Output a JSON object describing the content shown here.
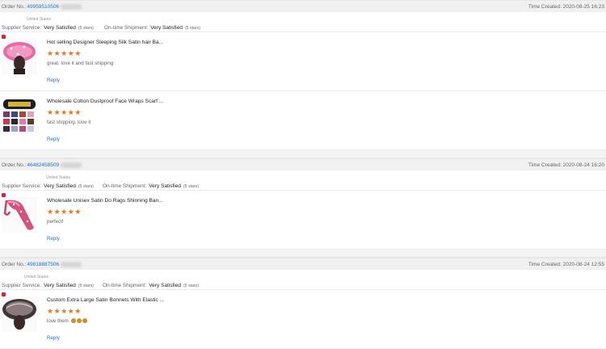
{
  "labels": {
    "order_no": "Order No.:",
    "time_created": "Time Created:",
    "supplier_service": "Supplier Service:",
    "on_time_shipment": "On-time Shipment:",
    "reply": "Reply"
  },
  "orders": [
    {
      "order_no": "49959510506",
      "time_created": "2020-08-25 16:23",
      "country": "United States",
      "supplier_service": "Very Satisfied",
      "supplier_stars": "(5 stars)",
      "shipment": "Very Satisfied",
      "shipment_stars": "(5 stars)",
      "items": [
        {
          "title": "Hot selling Designer Sleeping Silk Satin hair Ba...",
          "stars": "★★★★★",
          "comment": "great. love it and fast shipping",
          "thumb": "pink-bonnet"
        },
        {
          "title": "Wholesale Cotton Dustproof Face Wraps Scarf ...",
          "stars": "★★★★★",
          "comment": "fast shipping. love it",
          "thumb": "face-masks"
        }
      ]
    },
    {
      "order_no": "46482458509",
      "time_created": "2020-08-24 16:20",
      "country": "United States",
      "supplier_service": "Very Satisfied",
      "supplier_stars": "(5 stars)",
      "shipment": "Very Satisfied",
      "shipment_stars": "(5 stars)",
      "items": [
        {
          "title": "Wholesale Unisex Satin Do Rags Shinning Ban...",
          "stars": "★★★★★",
          "comment": "perfect!",
          "thumb": "durag"
        }
      ]
    },
    {
      "order_no": "49818887506",
      "time_created": "2020-08-24 12:55",
      "country": "United States",
      "supplier_service": "Very Satisfied",
      "supplier_stars": "(5 stars)",
      "shipment": "Very Satisfied",
      "shipment_stars": "(5 stars)",
      "items": [
        {
          "title": "Custom Extra Large Satin Bonnets With Elastic ...",
          "stars": "★★★★★",
          "comment": "love them",
          "thumb": "satin-bonnet"
        }
      ]
    }
  ]
}
